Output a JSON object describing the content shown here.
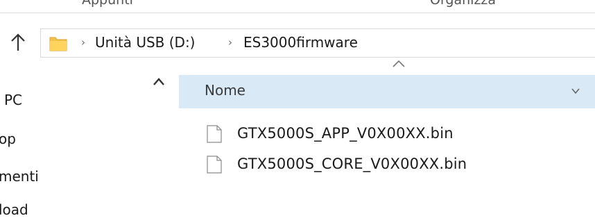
{
  "ribbon": {
    "group_left": "Appunti",
    "group_right": "Organizza"
  },
  "address_bar": {
    "breadcrumb": [
      "Unità USB (D:)",
      "ES3000firmware"
    ],
    "separator": "›"
  },
  "navigation_pane": {
    "items": [
      "PC",
      "op",
      "menti",
      "load"
    ]
  },
  "file_list": {
    "column_header": "Nome",
    "files": [
      {
        "name": "GTX5000S_APP_V0X00XX.bin",
        "icon": "document-icon"
      },
      {
        "name": "GTX5000S_CORE_V0X00XX.bin",
        "icon": "document-icon"
      }
    ]
  },
  "colors": {
    "selected_header_bg": "#d9e9f6",
    "folder_yellow": "#f3c24b"
  }
}
